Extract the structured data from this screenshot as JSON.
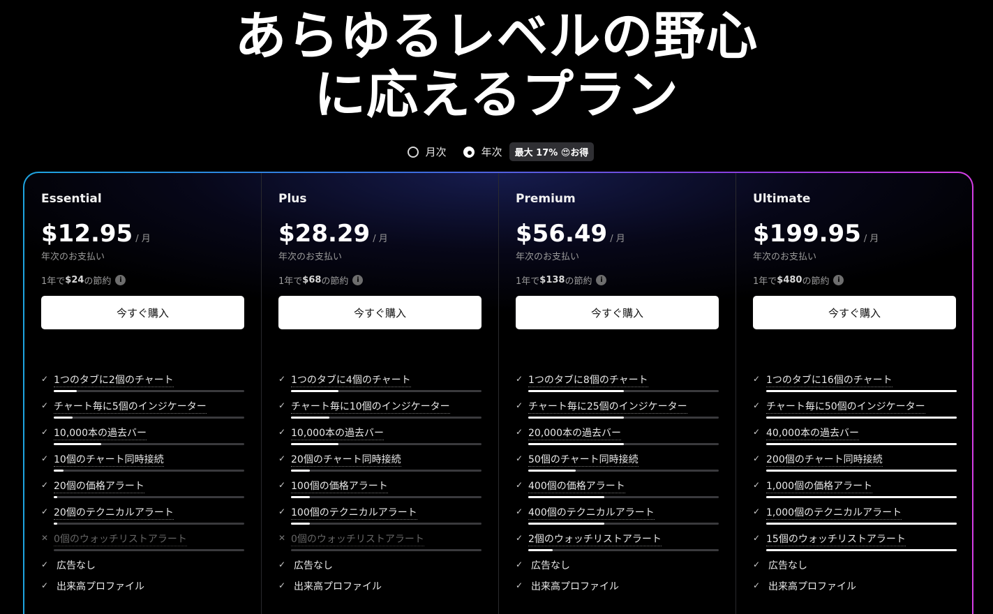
{
  "hero": {
    "line1": "あらゆるレベルの野心",
    "line2": "に応えるプラン"
  },
  "billing": {
    "monthly_label": "月次",
    "annual_label": "年次",
    "selected": "annual",
    "badge": "最大 17% 😍お得"
  },
  "colors": {
    "border_gradient": [
      "#1ea4e0",
      "#3a6fe0",
      "#8a3fe0",
      "#d53ee6"
    ],
    "background": "#000000"
  },
  "common": {
    "per_month": "/ 月",
    "billed": "年次のお支払い",
    "buy_label": "今すぐ購入",
    "save_prefix": "1年で",
    "save_suffix": " の節約"
  },
  "plans": [
    {
      "name": "Essential",
      "price": "$12.95",
      "savings": "$24",
      "features": [
        {
          "text": "1つのタブに2個のチャート",
          "level": 0.12
        },
        {
          "text": "チャート毎に5個のインジケーター",
          "level": 0.1
        },
        {
          "text": "10,000本の過去バー",
          "level": 0.25
        },
        {
          "text": "10個のチャート同時接続",
          "level": 0.05
        },
        {
          "text": "20個の価格アラート",
          "level": 0.02
        },
        {
          "text": "20個のテクニカルアラート",
          "level": 0.02
        },
        {
          "text": "0個のウォッチリストアラート",
          "level": 0,
          "disabled": true
        },
        {
          "text": "広告なし",
          "plain": true
        },
        {
          "text": "出来高プロファイル",
          "plain": true
        }
      ]
    },
    {
      "name": "Plus",
      "price": "$28.29",
      "savings": "$68",
      "features": [
        {
          "text": "1つのタブに4個のチャート",
          "level": 0.25
        },
        {
          "text": "チャート毎に10個のインジケーター",
          "level": 0.2
        },
        {
          "text": "10,000本の過去バー",
          "level": 0.25
        },
        {
          "text": "20個のチャート同時接続",
          "level": 0.1
        },
        {
          "text": "100個の価格アラート",
          "level": 0.1
        },
        {
          "text": "100個のテクニカルアラート",
          "level": 0.1
        },
        {
          "text": "0個のウォッチリストアラート",
          "level": 0,
          "disabled": true
        },
        {
          "text": "広告なし",
          "plain": true
        },
        {
          "text": "出来高プロファイル",
          "plain": true
        }
      ]
    },
    {
      "name": "Premium",
      "price": "$56.49",
      "savings": "$138",
      "features": [
        {
          "text": "1つのタブに8個のチャート",
          "level": 0.5
        },
        {
          "text": "チャート毎に25個のインジケーター",
          "level": 0.5
        },
        {
          "text": "20,000本の過去バー",
          "level": 0.5
        },
        {
          "text": "50個のチャート同時接続",
          "level": 0.25
        },
        {
          "text": "400個の価格アラート",
          "level": 0.4
        },
        {
          "text": "400個のテクニカルアラート",
          "level": 0.4
        },
        {
          "text": "2個のウォッチリストアラート",
          "level": 0.13
        },
        {
          "text": "広告なし",
          "plain": true
        },
        {
          "text": "出来高プロファイル",
          "plain": true
        }
      ]
    },
    {
      "name": "Ultimate",
      "price": "$199.95",
      "savings": "$480",
      "features": [
        {
          "text": "1つのタブに16個のチャート",
          "level": 1
        },
        {
          "text": "チャート毎に50個のインジケーター",
          "level": 1
        },
        {
          "text": "40,000本の過去バー",
          "level": 1
        },
        {
          "text": "200個のチャート同時接続",
          "level": 1
        },
        {
          "text": "1,000個の価格アラート",
          "level": 1
        },
        {
          "text": "1,000個のテクニカルアラート",
          "level": 1
        },
        {
          "text": "15個のウォッチリストアラート",
          "level": 1
        },
        {
          "text": "広告なし",
          "plain": true
        },
        {
          "text": "出来高プロファイル",
          "plain": true
        }
      ]
    }
  ]
}
